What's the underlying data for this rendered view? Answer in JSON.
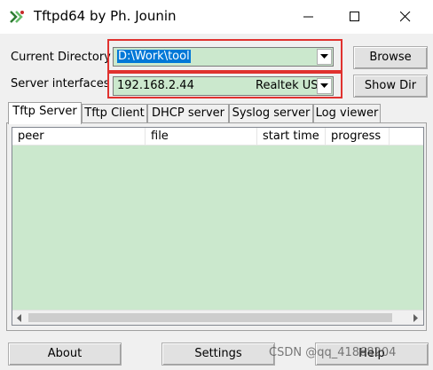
{
  "window": {
    "title": "Tftpd64 by Ph. Jounin"
  },
  "current_directory": {
    "label": "Current Directory",
    "value": "D:\\Work\\tool"
  },
  "server_interfaces": {
    "label": "Server interfaces",
    "ip": "192.168.2.44",
    "adapter": "Realtek US"
  },
  "buttons": {
    "browse": "Browse",
    "show_dir": "Show Dir",
    "about": "About",
    "settings": "Settings",
    "help": "Help"
  },
  "tabs": [
    "Tftp Server",
    "Tftp Client",
    "DHCP server",
    "Syslog server",
    "Log viewer"
  ],
  "table": {
    "columns": [
      "peer",
      "file",
      "start time",
      "progress"
    ],
    "rows": []
  },
  "watermark": "CSDN @qq_41868204",
  "colors": {
    "list_background": "#cbe8cd",
    "highlight_box": "#e0322f",
    "selection": "#0078d7"
  }
}
